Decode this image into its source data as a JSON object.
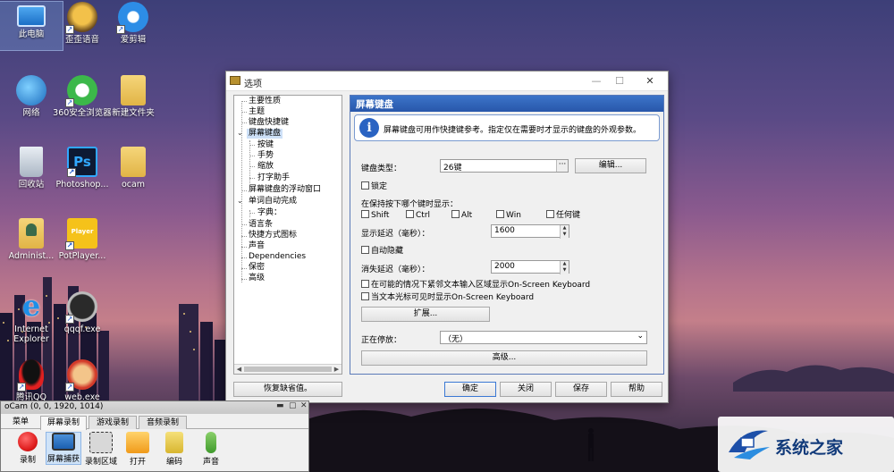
{
  "desktop": {
    "icons": [
      {
        "label": "此电脑"
      },
      {
        "label": "歪歪语音"
      },
      {
        "label": "爱剪辑"
      },
      {
        "label": "网络"
      },
      {
        "label": "360安全浏览器"
      },
      {
        "label": "新建文件夹"
      },
      {
        "label": "回收站"
      },
      {
        "label": "Photoshop..."
      },
      {
        "label": "ocam"
      },
      {
        "label": "Administ..."
      },
      {
        "label": "PotPlayer..."
      },
      {
        "label": "Internet Explorer"
      },
      {
        "label": "qqqf.exe"
      },
      {
        "label": "腾讯QQ"
      },
      {
        "label": "web.exe"
      }
    ],
    "ps_glyph": "Ps",
    "pot_glyph": "Player",
    "ie_glyph": "e"
  },
  "dialog": {
    "title": "选项",
    "tree": [
      "主要性质",
      "主题",
      "键盘快捷键",
      "屏幕键盘",
      "按键",
      "手势",
      "缩放",
      "打字助手",
      "屏幕键盘的浮动窗口",
      "单词自动完成",
      "字典：",
      "语言条",
      "快捷方式图标",
      "声音",
      "Dependencies",
      "保密",
      "高级"
    ],
    "panel_title": "屏幕键盘",
    "info_text": "屏幕键盘可用作快捷键参考。指定仅在需要时才显示的键盘的外观参数。",
    "keyboard_type_label": "键盘类型：",
    "keyboard_type_value": "26键",
    "edit_button": "编辑...",
    "lock_label": "锁定",
    "show_on_hold_label": "在保持按下哪个键时显示：",
    "mod_keys": [
      "Shift",
      "Ctrl",
      "Alt",
      "Win",
      "任何键"
    ],
    "show_delay_label": "显示延迟（毫秒）：",
    "show_delay_value": "1600",
    "auto_hide_label": "自动隐藏",
    "hide_delay_label": "消失延迟（毫秒）：",
    "hide_delay_value": "2000",
    "option1": "在可能的情况下紧邻文本输入区域显示On-Screen Keyboard",
    "option2": "当文本光标可见时显示On-Screen Keyboard",
    "extend_button": "扩展...",
    "playing_label": "正在停放：",
    "playing_value": "（无）",
    "advanced_button": "高级...",
    "restore_button": "恢复缺省值。",
    "ok_button": "确定",
    "close_button": "关闭",
    "save_button": "保存",
    "help_button": "帮助"
  },
  "ocam": {
    "title": "oCam (0, 0, 1920, 1014)",
    "tabs": [
      "菜单",
      "屏幕录制",
      "游戏录制",
      "音频录制"
    ],
    "tools": [
      "录制",
      "屏幕捕获",
      "录制区域",
      "打开",
      "编码",
      "声音"
    ]
  },
  "watermark": {
    "text": "系统之家"
  },
  "colors": {
    "accent": "#2857aa",
    "record_red": "#e02020"
  }
}
